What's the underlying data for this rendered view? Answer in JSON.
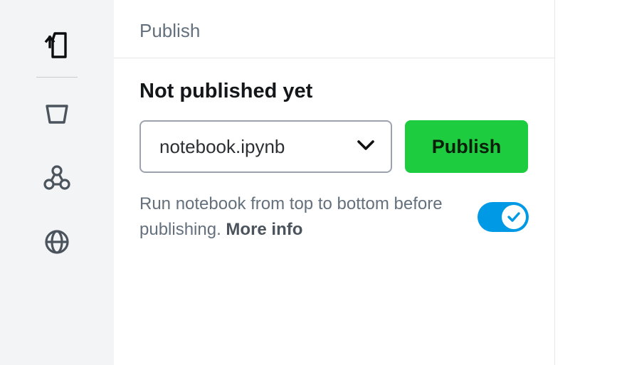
{
  "panel": {
    "title": "Publish",
    "status": "Not published yet",
    "dropdown": {
      "selected": "notebook.ipynb"
    },
    "publish_button": "Publish",
    "run_option_text": "Run notebook from top to bottom before publishing. ",
    "more_info": "More info",
    "toggle_on": true
  },
  "sidebar": {
    "icons": [
      "publish-icon",
      "bucket-icon",
      "graph-icon",
      "globe-icon"
    ]
  },
  "colors": {
    "accent_green": "#1ecc40",
    "toggle_blue": "#0099e5"
  }
}
